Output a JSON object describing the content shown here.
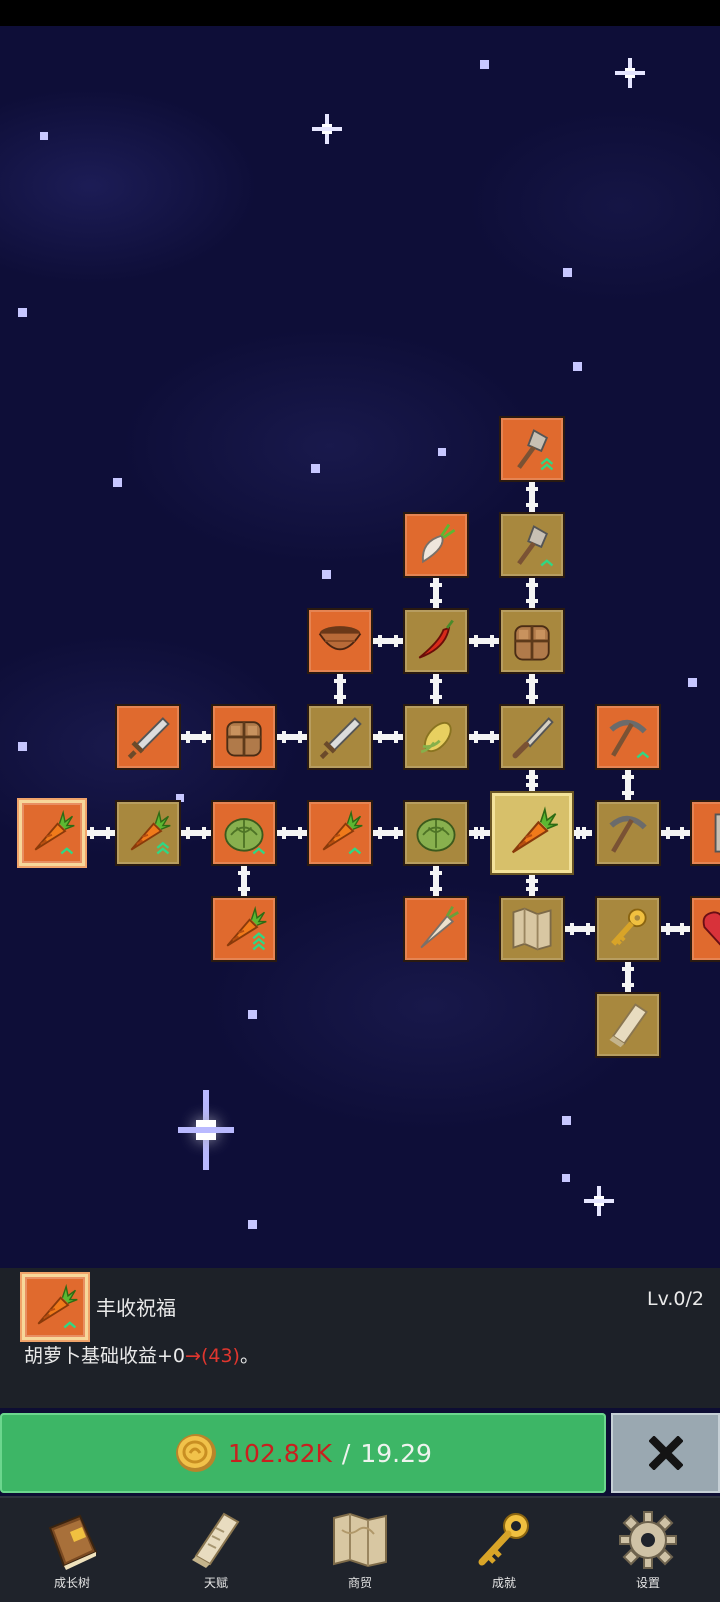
{
  "colors": {
    "node_orange": "#e06a2e",
    "node_olive": "#a8883e",
    "node_selected": "#d7c06a",
    "button_green": "#3db666",
    "cost_red": "#c8201f",
    "panel_bg": "#1d2128"
  },
  "skill_tree": {
    "nodes": [
      {
        "id": "carrot-start",
        "icon": "carrot-icon",
        "style": "start",
        "arrows": 1
      },
      {
        "id": "carrot-upgrade-2",
        "icon": "carrot-icon",
        "style": "olive",
        "arrows": 2
      },
      {
        "id": "cabbage-1",
        "icon": "cabbage-icon",
        "style": "orange",
        "arrows": 1
      },
      {
        "id": "carrot-upgrade-3",
        "icon": "carrot-icon",
        "style": "orange",
        "arrows": 3
      },
      {
        "id": "carrot-upgrade-1b",
        "icon": "carrot-icon",
        "style": "olive",
        "arrows": 1
      },
      {
        "id": "cabbage-2",
        "icon": "cabbage-icon",
        "style": "olive",
        "arrows": 0
      },
      {
        "id": "carrot-selected",
        "icon": "carrot-icon",
        "style": "selected",
        "arrows": 0
      },
      {
        "id": "pickaxe-2",
        "icon": "pickaxe-icon",
        "style": "olive",
        "arrows": 0
      },
      {
        "id": "partial-right-1",
        "icon": "tool-icon",
        "style": "orange",
        "arrows": 0
      },
      {
        "id": "sword-1",
        "icon": "sword-icon",
        "style": "orange",
        "arrows": 0
      },
      {
        "id": "backpack-1",
        "icon": "backpack-icon",
        "style": "orange",
        "arrows": 0
      },
      {
        "id": "sword-2",
        "icon": "sword-icon",
        "style": "olive",
        "arrows": 0
      },
      {
        "id": "corn",
        "icon": "corn-icon",
        "style": "olive",
        "arrows": 0
      },
      {
        "id": "knife",
        "icon": "knife-icon",
        "style": "olive",
        "arrows": 0
      },
      {
        "id": "pickaxe-1",
        "icon": "pickaxe-icon",
        "style": "orange",
        "arrows": 1
      },
      {
        "id": "bowl",
        "icon": "bowl-icon",
        "style": "orange",
        "arrows": 0
      },
      {
        "id": "chili",
        "icon": "chili-icon",
        "style": "olive",
        "arrows": 0
      },
      {
        "id": "backpack-2",
        "icon": "backpack-icon",
        "style": "olive",
        "arrows": 0
      },
      {
        "id": "radish",
        "icon": "radish-icon",
        "style": "orange",
        "arrows": 0
      },
      {
        "id": "shovel-2",
        "icon": "shovel-icon",
        "style": "olive",
        "arrows": 1
      },
      {
        "id": "shovel-1",
        "icon": "shovel-icon",
        "style": "orange",
        "arrows": 2
      },
      {
        "id": "carrot-upgrade-lower",
        "icon": "carrot-icon",
        "style": "orange",
        "arrows": 3
      },
      {
        "id": "parsnip",
        "icon": "parsnip-icon",
        "style": "orange",
        "arrows": 0
      },
      {
        "id": "map",
        "icon": "map-icon",
        "style": "olive",
        "arrows": 0
      },
      {
        "id": "key",
        "icon": "key-icon",
        "style": "olive",
        "arrows": 0
      },
      {
        "id": "partial-right-2",
        "icon": "heart-icon",
        "style": "orange",
        "arrows": 0
      },
      {
        "id": "scroll",
        "icon": "scroll-icon",
        "style": "olive",
        "arrows": 0
      }
    ]
  },
  "info": {
    "icon": "carrot-icon",
    "title": "丰收祝福",
    "level": "Lv.0/2",
    "desc_prefix": "胡萝卜基础收益+0",
    "desc_arrow": "→",
    "desc_new": "(43)",
    "desc_suffix": "。"
  },
  "upgrade": {
    "cost": "102.82K",
    "separator": "/",
    "have": "19.29"
  },
  "nav": [
    {
      "label": "成长树",
      "icon": "book-icon"
    },
    {
      "label": "天赋",
      "icon": "scroll-icon"
    },
    {
      "label": "商贸",
      "icon": "map-icon"
    },
    {
      "label": "成就",
      "icon": "key-icon"
    },
    {
      "label": "设置",
      "icon": "gear-icon"
    }
  ]
}
